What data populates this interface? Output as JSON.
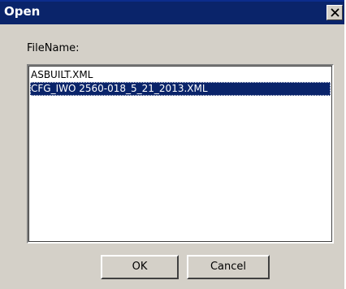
{
  "window": {
    "title": "Open",
    "close_icon": "close-x-icon"
  },
  "form": {
    "filename_label": "FileName:"
  },
  "file_list": {
    "items": [
      {
        "name": "ASBUILT.XML",
        "selected": false
      },
      {
        "name": "CFG_IWO 2560-018_5_21_2013.XML",
        "selected": true
      }
    ]
  },
  "buttons": {
    "ok_label": "OK",
    "cancel_label": "Cancel"
  },
  "colors": {
    "titlebar": "#0a246a",
    "dialog_face": "#d4d0c8",
    "selection": "#0a246a"
  }
}
